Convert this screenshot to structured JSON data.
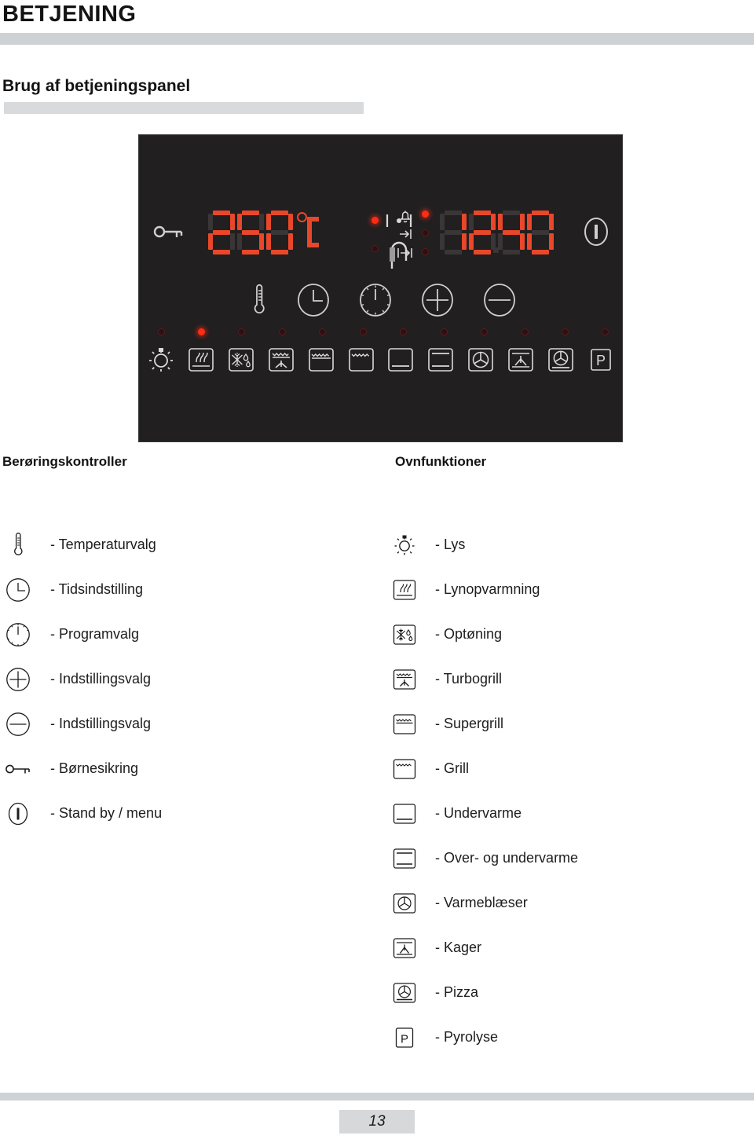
{
  "document": {
    "chapter_title": "BETJENING",
    "section_title": "Brug af betjeningspanel",
    "page_number": "13"
  },
  "control_panel": {
    "temperature_display": "250",
    "temperature_unit": "°C",
    "clock_display": "12.40",
    "left_icon": "key-icon",
    "right_icon": "power-icon",
    "touch_controls": [
      {
        "name": "thermometer-icon"
      },
      {
        "name": "clock-icon"
      },
      {
        "name": "timer-icon"
      },
      {
        "name": "plus-icon"
      },
      {
        "name": "minus-icon"
      }
    ],
    "function_buttons": [
      {
        "name": "light-icon",
        "led": "off"
      },
      {
        "name": "fast-preheat-icon",
        "led": "on"
      },
      {
        "name": "defrost-icon",
        "led": "off"
      },
      {
        "name": "turbogrill-icon",
        "led": "off"
      },
      {
        "name": "supergrill-icon",
        "led": "off"
      },
      {
        "name": "grill-icon",
        "led": "off"
      },
      {
        "name": "bottom-heat-icon",
        "led": "off"
      },
      {
        "name": "top-bottom-heat-icon",
        "led": "off"
      },
      {
        "name": "fan-heat-icon",
        "led": "off"
      },
      {
        "name": "cakes-icon",
        "led": "off"
      },
      {
        "name": "pizza-icon",
        "led": "off"
      },
      {
        "name": "pyrolysis-icon",
        "led": "off"
      }
    ],
    "indicator_leds": [
      {
        "name": "probe-led-top",
        "state": "on"
      },
      {
        "name": "probe-led-bottom",
        "state": "off"
      },
      {
        "name": "bell-led",
        "state": "on"
      },
      {
        "name": "end-time-led",
        "state": "off"
      },
      {
        "name": "duration-led",
        "state": "off"
      }
    ]
  },
  "legend": {
    "left": {
      "heading": "Berøringskontroller",
      "items": [
        {
          "icon": "thermometer-icon",
          "label": "- Temperaturvalg"
        },
        {
          "icon": "clock-icon",
          "label": "- Tidsindstilling"
        },
        {
          "icon": "timer-icon",
          "label": "- Programvalg"
        },
        {
          "icon": "plus-icon",
          "label": "- Indstillingsvalg"
        },
        {
          "icon": "minus-icon",
          "label": "- Indstillingsvalg"
        },
        {
          "icon": "key-icon",
          "label": "- Børnesikring"
        },
        {
          "icon": "power-icon",
          "label": "- Stand by / menu"
        }
      ]
    },
    "right": {
      "heading": "Ovnfunktioner",
      "items": [
        {
          "icon": "light-icon",
          "label": "- Lys"
        },
        {
          "icon": "fast-preheat-icon",
          "label": "- Lynopvarmning"
        },
        {
          "icon": "defrost-icon",
          "label": "- Optøning"
        },
        {
          "icon": "turbogrill-icon",
          "label": "- Turbogrill"
        },
        {
          "icon": "supergrill-icon",
          "label": "- Supergrill"
        },
        {
          "icon": "grill-icon",
          "label": "- Grill"
        },
        {
          "icon": "bottom-heat-icon",
          "label": "- Undervarme"
        },
        {
          "icon": "top-bottom-heat-icon",
          "label": "- Over- og undervarme"
        },
        {
          "icon": "fan-heat-icon",
          "label": "- Varmeblæser"
        },
        {
          "icon": "cakes-icon",
          "label": "- Kager"
        },
        {
          "icon": "pizza-icon",
          "label": "- Pizza"
        },
        {
          "icon": "pyrolysis-icon",
          "label": "- Pyrolyse"
        }
      ]
    }
  },
  "colors": {
    "rule_grey": "#ced2d5",
    "led_red": "#ff2b14",
    "segment_on": "#e8472a",
    "segment_off": "#3a3537",
    "panel_black": "#211f20"
  }
}
